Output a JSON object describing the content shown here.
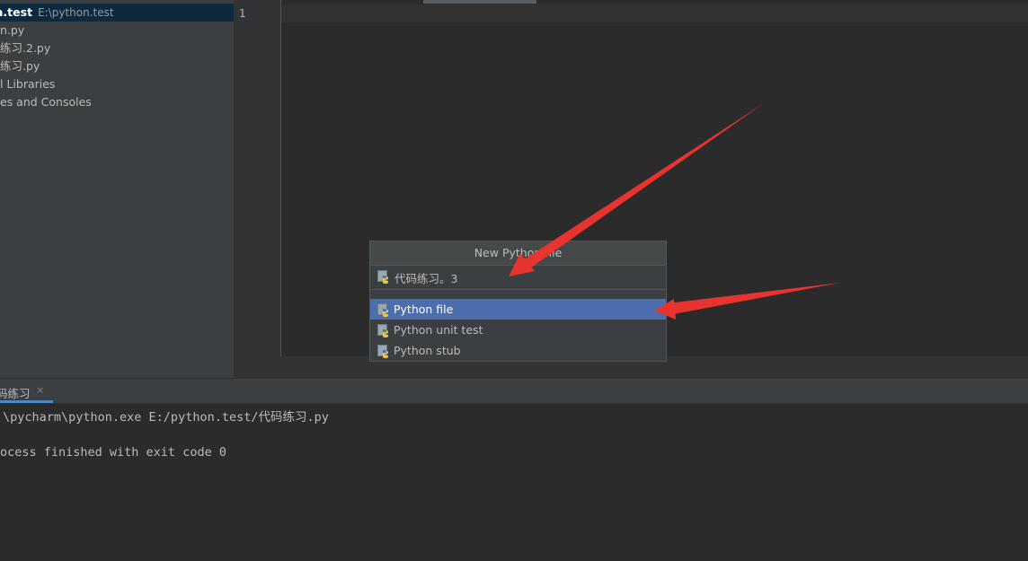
{
  "project_tree": {
    "root_name": "a.test",
    "root_path": "E:\\python.test",
    "items": [
      {
        "label": "n.py"
      },
      {
        "label": "练习.2.py"
      },
      {
        "label": "练习.py"
      },
      {
        "label": "l Libraries"
      },
      {
        "label": "es and Consoles"
      }
    ]
  },
  "editor": {
    "line_number": "1"
  },
  "popup": {
    "title": "New Python file",
    "name_value": "代码练习。3",
    "items": [
      {
        "label": "Python file",
        "icon": "python-file-icon",
        "selected": true
      },
      {
        "label": "Python unit test",
        "icon": "python-file-icon",
        "selected": false
      },
      {
        "label": "Python stub",
        "icon": "python-file-icon",
        "selected": false
      }
    ]
  },
  "run_panel": {
    "tab_label": "码练习",
    "close_glyph": "×",
    "lines": [
      "\\pycharm\\python.exe E:/python.test/代码练习.py",
      "ocess finished with exit code 0"
    ]
  },
  "colors": {
    "selection": "#4b6eaf",
    "annotation_arrow": "#e8342f"
  }
}
